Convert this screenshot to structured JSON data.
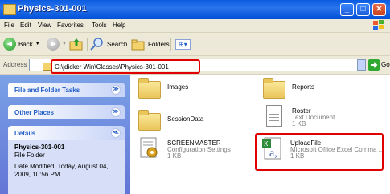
{
  "window": {
    "title": "Physics-301-001",
    "minimize": "_",
    "maximize": "□",
    "close": "✕"
  },
  "menu": [
    "File",
    "Edit",
    "View",
    "Favorites",
    "Tools",
    "Help"
  ],
  "toolbar": {
    "back": "Back",
    "search": "Search",
    "folders": "Folders",
    "views": "⊞▾"
  },
  "address": {
    "label": "Address",
    "path": "C:\\jdicker Win\\Classes\\Physics-301-001",
    "go": "Go"
  },
  "tasks": {
    "file_folder": "File and Folder Tasks",
    "other_places": "Other Places",
    "details": "Details",
    "expand_glyph": "≫",
    "collapse_glyph": "≪"
  },
  "details": {
    "name": "Physics-301-001",
    "type": "File Folder",
    "modified": "Date Modified: Today, August 04, 2009, 10:56 PM"
  },
  "items": {
    "images": {
      "name": "Images"
    },
    "reports": {
      "name": "Reports"
    },
    "sessiondata": {
      "name": "SessionData"
    },
    "roster": {
      "name": "Roster",
      "type": "Text Document",
      "size": "1 KB"
    },
    "screenmaster": {
      "name": "SCREENMASTER",
      "type": "Configuration Settings",
      "size": "1 KB"
    },
    "uploadfile": {
      "name": "UploadFile",
      "type": "Microsoft Office Excel Comma ...",
      "size": "1 KB"
    }
  },
  "colors": {
    "accent": "#215dc6",
    "highlight": "#e00000",
    "title_bar": "#0a5ce0"
  }
}
